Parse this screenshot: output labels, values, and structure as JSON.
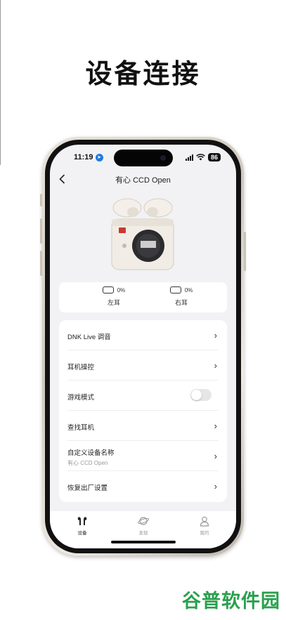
{
  "promo": {
    "headline": "设备连接"
  },
  "status_bar": {
    "time": "11:19",
    "battery": "86"
  },
  "nav": {
    "title": "有心 CCD Open"
  },
  "earbuds": [
    {
      "label": "左耳",
      "battery": "0%"
    },
    {
      "label": "右耳",
      "battery": "0%"
    }
  ],
  "settings": {
    "items": [
      {
        "label": "DNK Live 调音",
        "control": "chevron"
      },
      {
        "label": "耳机操控",
        "control": "chevron"
      },
      {
        "label": "游戏模式",
        "control": "toggle",
        "enabled": false
      },
      {
        "label": "查找耳机",
        "control": "chevron"
      },
      {
        "label": "自定义设备名称",
        "sub": "有心 CCD Open",
        "control": "chevron"
      },
      {
        "label": "恢复出厂设置",
        "control": "chevron"
      }
    ]
  },
  "tabs": [
    {
      "label": "设备",
      "icon": "earbuds-icon",
      "active": true
    },
    {
      "label": "发现",
      "icon": "planet-icon",
      "active": false
    },
    {
      "label": "我的",
      "icon": "person-icon",
      "active": false
    }
  ],
  "watermark": {
    "text": "谷普软件园"
  },
  "colors": {
    "accent": "#1f7ae0",
    "watermark": "#2aa04e",
    "screen_bg": "#f2f2f4"
  }
}
